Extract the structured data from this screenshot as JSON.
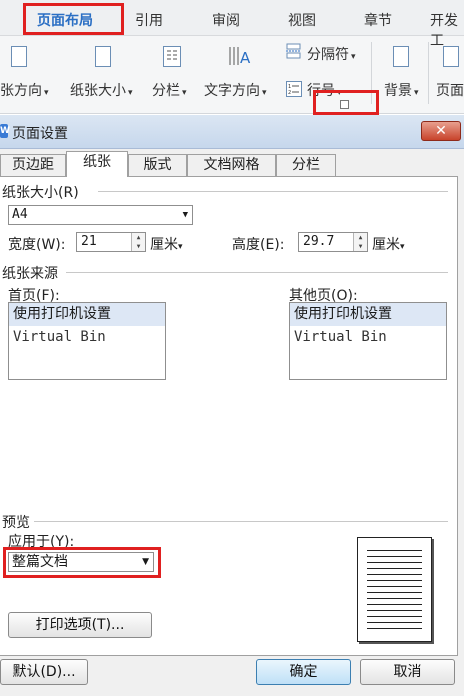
{
  "ribbon": {
    "tabs": [
      "页面布局",
      "引用",
      "审阅",
      "视图",
      "章节",
      "开发工"
    ],
    "active_tab": "页面布局",
    "buttons": {
      "orientation": "张方向",
      "size": "纸张大小",
      "columns": "分栏",
      "text_direction": "文字方向",
      "separator": "分隔符",
      "line_number": "行号",
      "background": "背景",
      "page_border": "页面"
    }
  },
  "dialog": {
    "title": "页面设置",
    "close_glyph": "✕",
    "tabs": [
      "页边距",
      "纸张",
      "版式",
      "文档网格",
      "分栏"
    ],
    "active_tab": "纸张",
    "paper_size": {
      "section": "纸张大小(R)",
      "selected": "A4",
      "width_label": "宽度(W):",
      "width_value": "21",
      "height_label": "高度(E):",
      "height_value": "29.7",
      "unit": "厘米"
    },
    "paper_source": {
      "section": "纸张来源",
      "first_page_label": "首页(F):",
      "other_pages_label": "其他页(O):",
      "first_page_options": [
        "使用打印机设置",
        "Virtual Bin"
      ],
      "other_pages_options": [
        "使用打印机设置",
        "Virtual Bin"
      ]
    },
    "preview": {
      "section": "预览",
      "apply_label": "应用于(Y):",
      "apply_value": "整篇文档"
    },
    "print_options_button": "打印选项(T)...",
    "default_button": "默认(D)...",
    "ok_button": "确定",
    "cancel_button": "取消"
  },
  "colors": {
    "highlight": "#e02020",
    "active_tab_text": "#2b6fc4",
    "close_button": "#c8432b"
  }
}
